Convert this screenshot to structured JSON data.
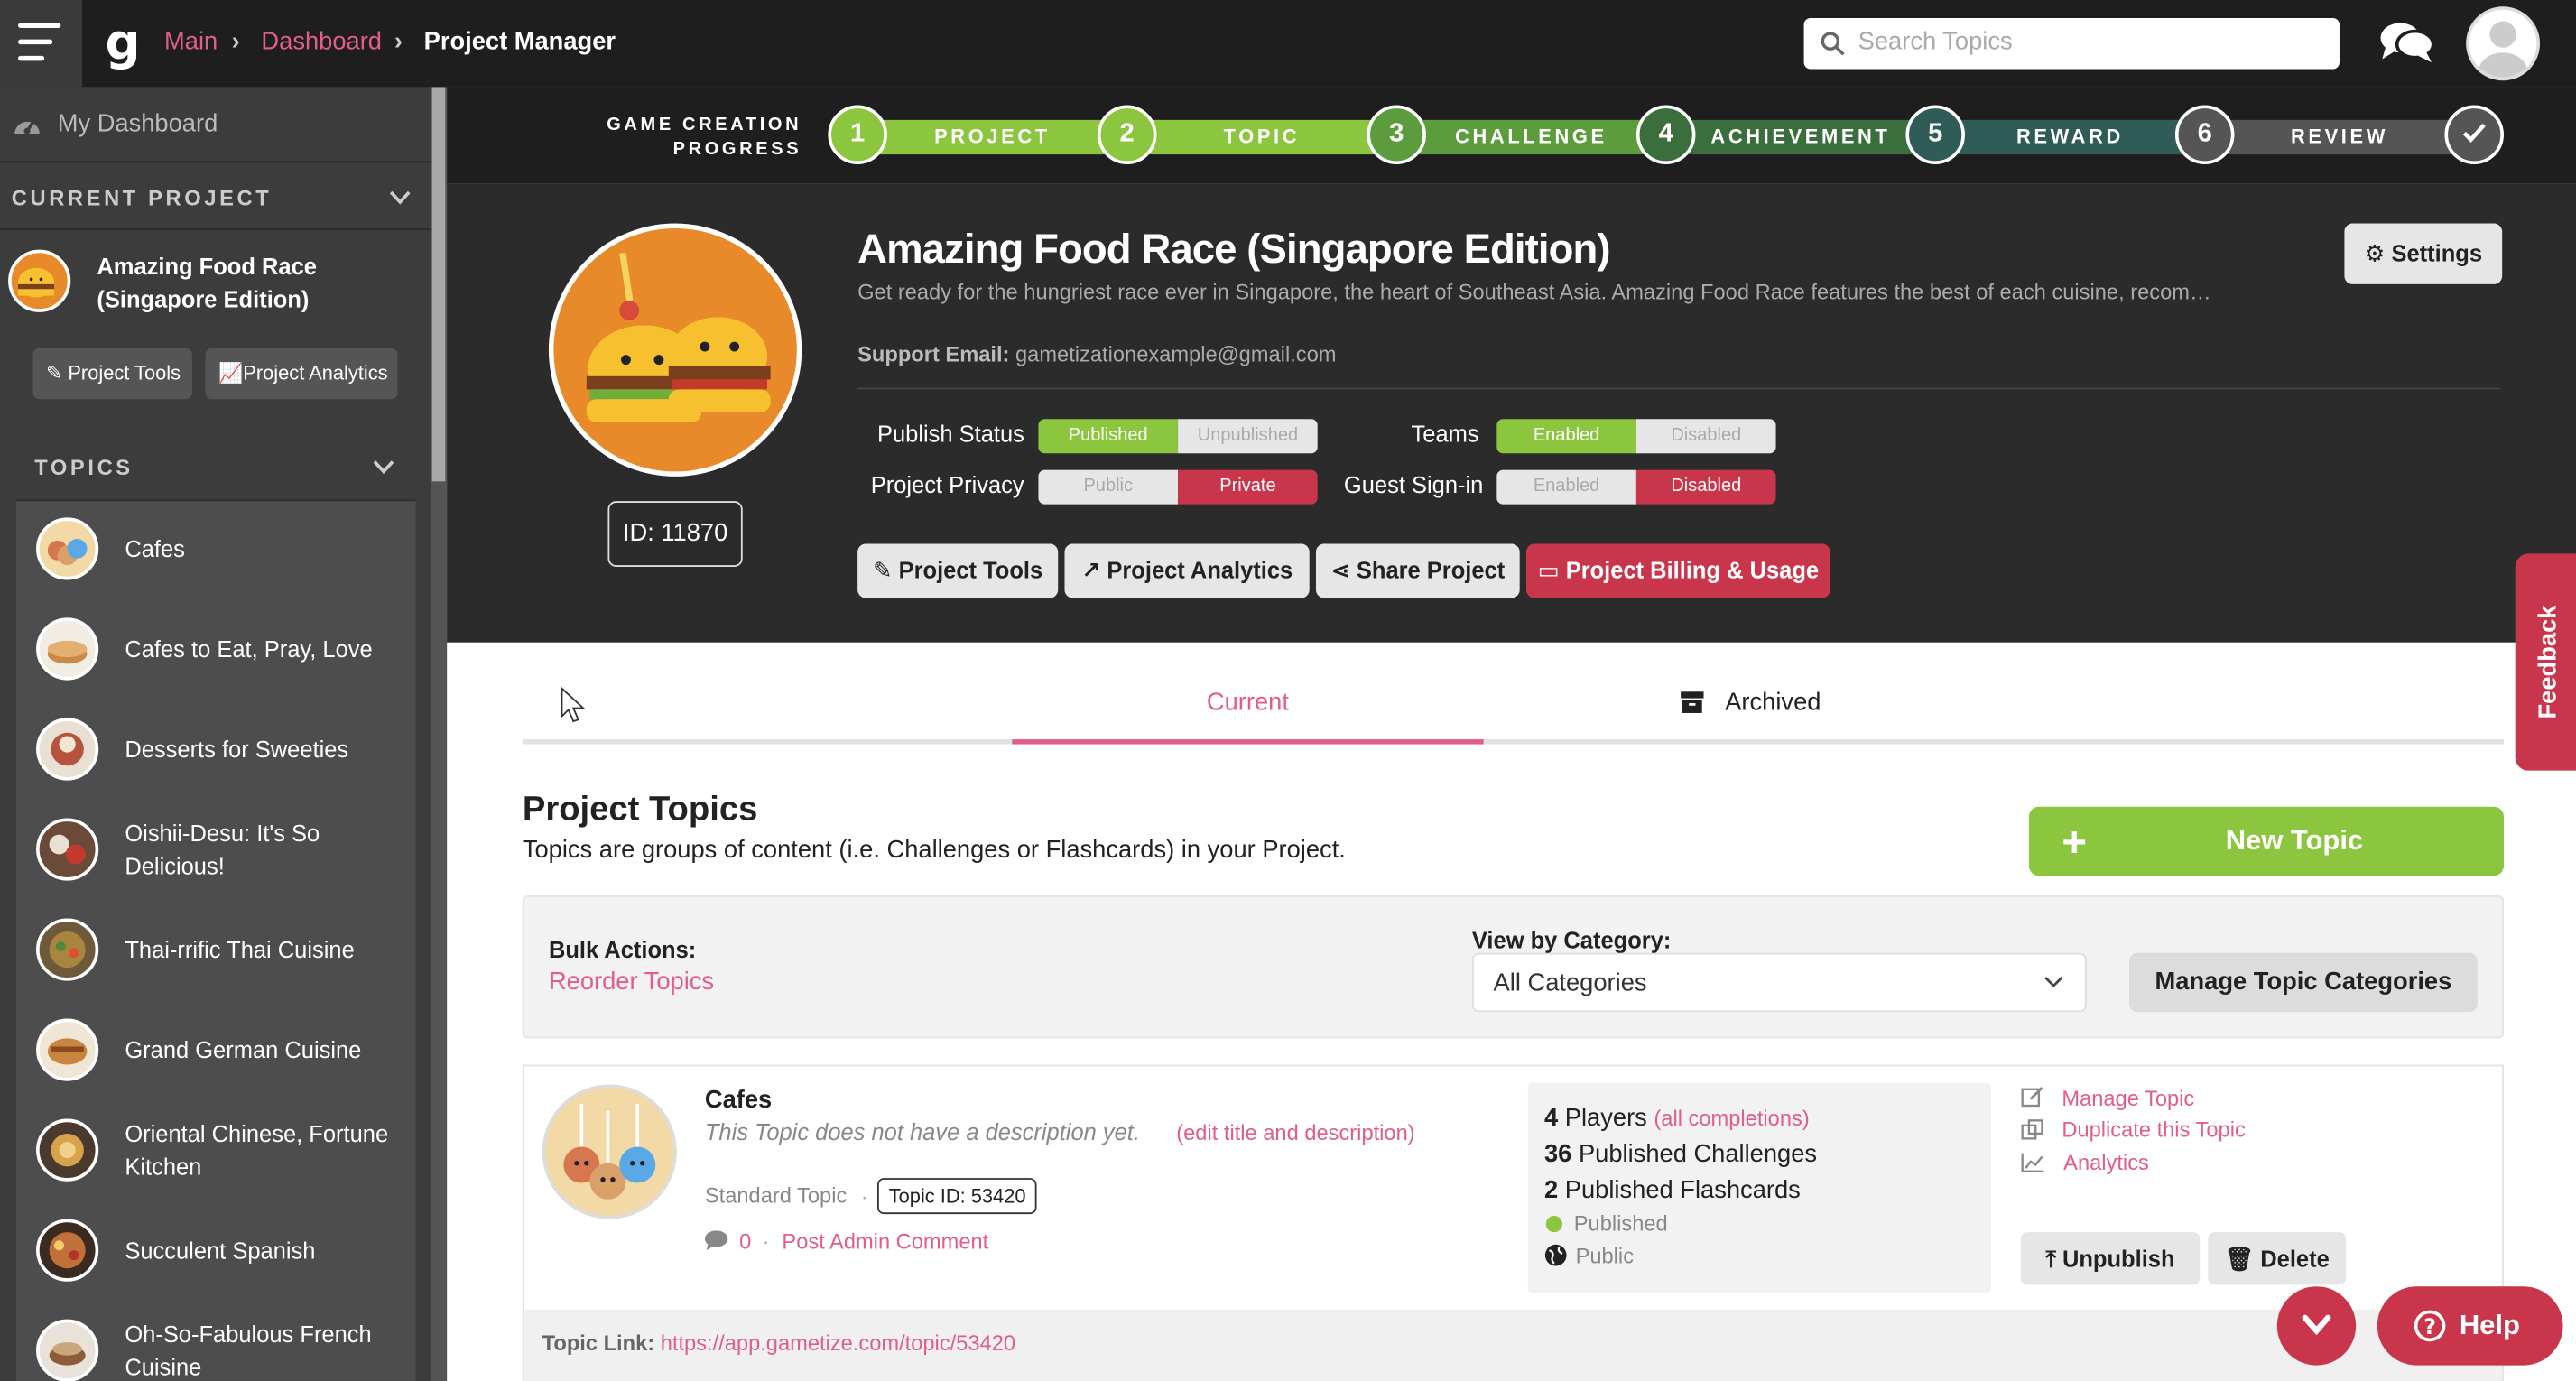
{
  "breadcrumb": {
    "main": "Main",
    "dashboard": "Dashboard",
    "current": "Project Manager"
  },
  "logo": "g",
  "search": {
    "placeholder": "Search Topics"
  },
  "sidebar": {
    "dashboard": "My Dashboard",
    "current_project_label": "CURRENT PROJECT",
    "project_name": "Amazing Food Race (Singapore Edition)",
    "project_tools": "Project Tools",
    "project_analytics": "Project Analytics",
    "topics_label": "TOPICS",
    "topics": [
      {
        "label": "Cafes"
      },
      {
        "label": "Cafes to Eat, Pray, Love"
      },
      {
        "label": "Desserts for Sweeties"
      },
      {
        "label": "Oishii-Desu: It's So Delicious!"
      },
      {
        "label": "Thai-rrific Thai Cuisine"
      },
      {
        "label": "Grand German Cuisine"
      },
      {
        "label": "Oriental Chinese, Fortune Kitchen"
      },
      {
        "label": "Succulent Spanish"
      },
      {
        "label": "Oh-So-Fabulous French Cuisine"
      }
    ]
  },
  "progress": {
    "title": "GAME CREATION PROGRESS",
    "steps": [
      {
        "num": "1",
        "label": "PROJECT"
      },
      {
        "num": "2",
        "label": "TOPIC"
      },
      {
        "num": "3",
        "label": "CHALLENGE"
      },
      {
        "num": "4",
        "label": "ACHIEVEMENT"
      },
      {
        "num": "5",
        "label": "REWARD"
      },
      {
        "num": "6",
        "label": "REVIEW"
      }
    ],
    "colors": {
      "green": "#8cc63f",
      "mid_green": "#5d9c3d",
      "dark_green": "#3a6e3c",
      "teal": "#2f5c57",
      "gray": "#555555"
    }
  },
  "project": {
    "title": "Amazing Food Race (Singapore Edition)",
    "description": "Get ready for the hungriest race ever in Singapore, the heart of Southeast Asia. Amazing Food Race features the best of each cuisine, recommended by the locals and loved by all.",
    "support_label": "Support Email:",
    "support_email": "gametizationexample@gmail.com",
    "id_label": "ID: 11870",
    "settings": "Settings",
    "publish_status": {
      "label": "Publish Status",
      "on": "Published",
      "off": "Unpublished"
    },
    "teams": {
      "label": "Teams",
      "on": "Enabled",
      "off": "Disabled"
    },
    "privacy": {
      "label": "Project Privacy",
      "off": "Public",
      "on": "Private"
    },
    "guest": {
      "label": "Guest Sign-in",
      "off": "Enabled",
      "on": "Disabled"
    },
    "buttons": {
      "tools": "Project Tools",
      "analytics": "Project Analytics",
      "share": "Share Project",
      "billing": "Project Billing & Usage"
    }
  },
  "tabs": {
    "current": "Current",
    "archived": "Archived"
  },
  "topics_section": {
    "title": "Project Topics",
    "subtitle": "Topics are groups of content (i.e. Challenges or Flashcards) in your Project.",
    "new_topic": "New Topic",
    "bulk_label": "Bulk Actions:",
    "reorder": "Reorder Topics",
    "view_by": "View by Category:",
    "category_value": "All Categories",
    "manage_categories": "Manage Topic Categories"
  },
  "topic_card": {
    "title": "Cafes",
    "no_desc": "This Topic does not have a description yet.",
    "edit_link": "(edit title and description)",
    "type": "Standard Topic",
    "id_badge": "Topic ID: 53420",
    "comments": "0",
    "post_comment": "Post Admin Comment",
    "players_num": "4",
    "players_text": "Players",
    "completions": "(all completions)",
    "challenges_num": "36",
    "challenges_text": "Published Challenges",
    "flashcards_num": "2",
    "flashcards_text": "Published Flashcards",
    "status_published": "Published",
    "status_public": "Public",
    "manage": "Manage Topic",
    "duplicate": "Duplicate this Topic",
    "analytics": "Analytics",
    "unpublish": "Unpublish",
    "delete": "Delete",
    "link_label": "Topic Link:",
    "link": "https://app.gametize.com/topic/53420"
  },
  "feedback": "Feedback",
  "help": "Help",
  "accent": "#e05d8c",
  "brand_red": "#c9364b",
  "brand_green": "#8cc63f"
}
